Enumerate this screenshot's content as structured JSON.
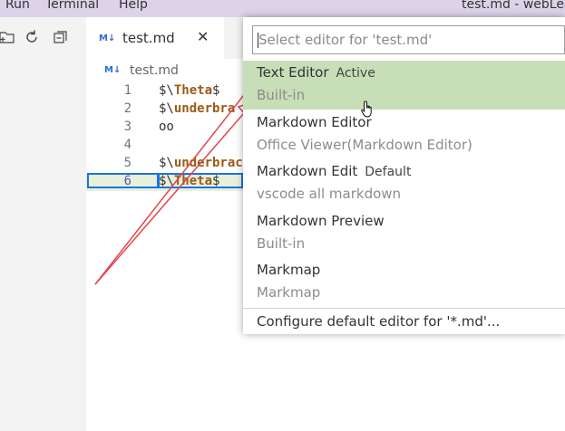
{
  "menubar": {
    "items": [
      "Run",
      "Terminal",
      "Help"
    ],
    "window_title": "test.md - webLea"
  },
  "sidebar": {
    "icons": [
      "new-folder-icon",
      "refresh-icon",
      "collapse-all-icon"
    ]
  },
  "tab": {
    "icon": "M↓",
    "label": "test.md",
    "close": "✕"
  },
  "breadcrumb": {
    "icon": "M↓",
    "label": "test.md"
  },
  "editor": {
    "lines": [
      {
        "num": "1",
        "prefix": "$\\",
        "kw": "Theta",
        "suffix": "$"
      },
      {
        "num": "2",
        "prefix": "$\\",
        "kw": "underbra",
        "suffix": ""
      },
      {
        "num": "3",
        "prefix": "oo",
        "kw": "",
        "suffix": ""
      },
      {
        "num": "4",
        "prefix": "",
        "kw": "",
        "suffix": ""
      },
      {
        "num": "5",
        "prefix": "$\\",
        "kw": "underbrac",
        "suffix": ""
      },
      {
        "num": "6",
        "prefix": "$\\",
        "kw": "Theta",
        "suffix": "$"
      }
    ]
  },
  "picker": {
    "placeholder": "Select editor for 'test.md'",
    "items": [
      {
        "title": "Text Editor",
        "desc": "Active",
        "sub": "Built-in"
      },
      {
        "title": "Markdown Editor",
        "desc": "",
        "sub": "Office Viewer(Markdown Editor)"
      },
      {
        "title": "Markdown Edit",
        "desc": "Default",
        "sub": "vscode all markdown"
      },
      {
        "title": "Markdown Preview",
        "desc": "",
        "sub": "Built-in"
      },
      {
        "title": "Markmap",
        "desc": "",
        "sub": "Markmap"
      }
    ],
    "configure_label": "Configure default editor for '*.md'..."
  },
  "colors": {
    "selected_item": "#c7deb6",
    "annotation_arrow": "#e0474c",
    "keyword": "#9b5a16",
    "line_box": "#1a73e8"
  }
}
